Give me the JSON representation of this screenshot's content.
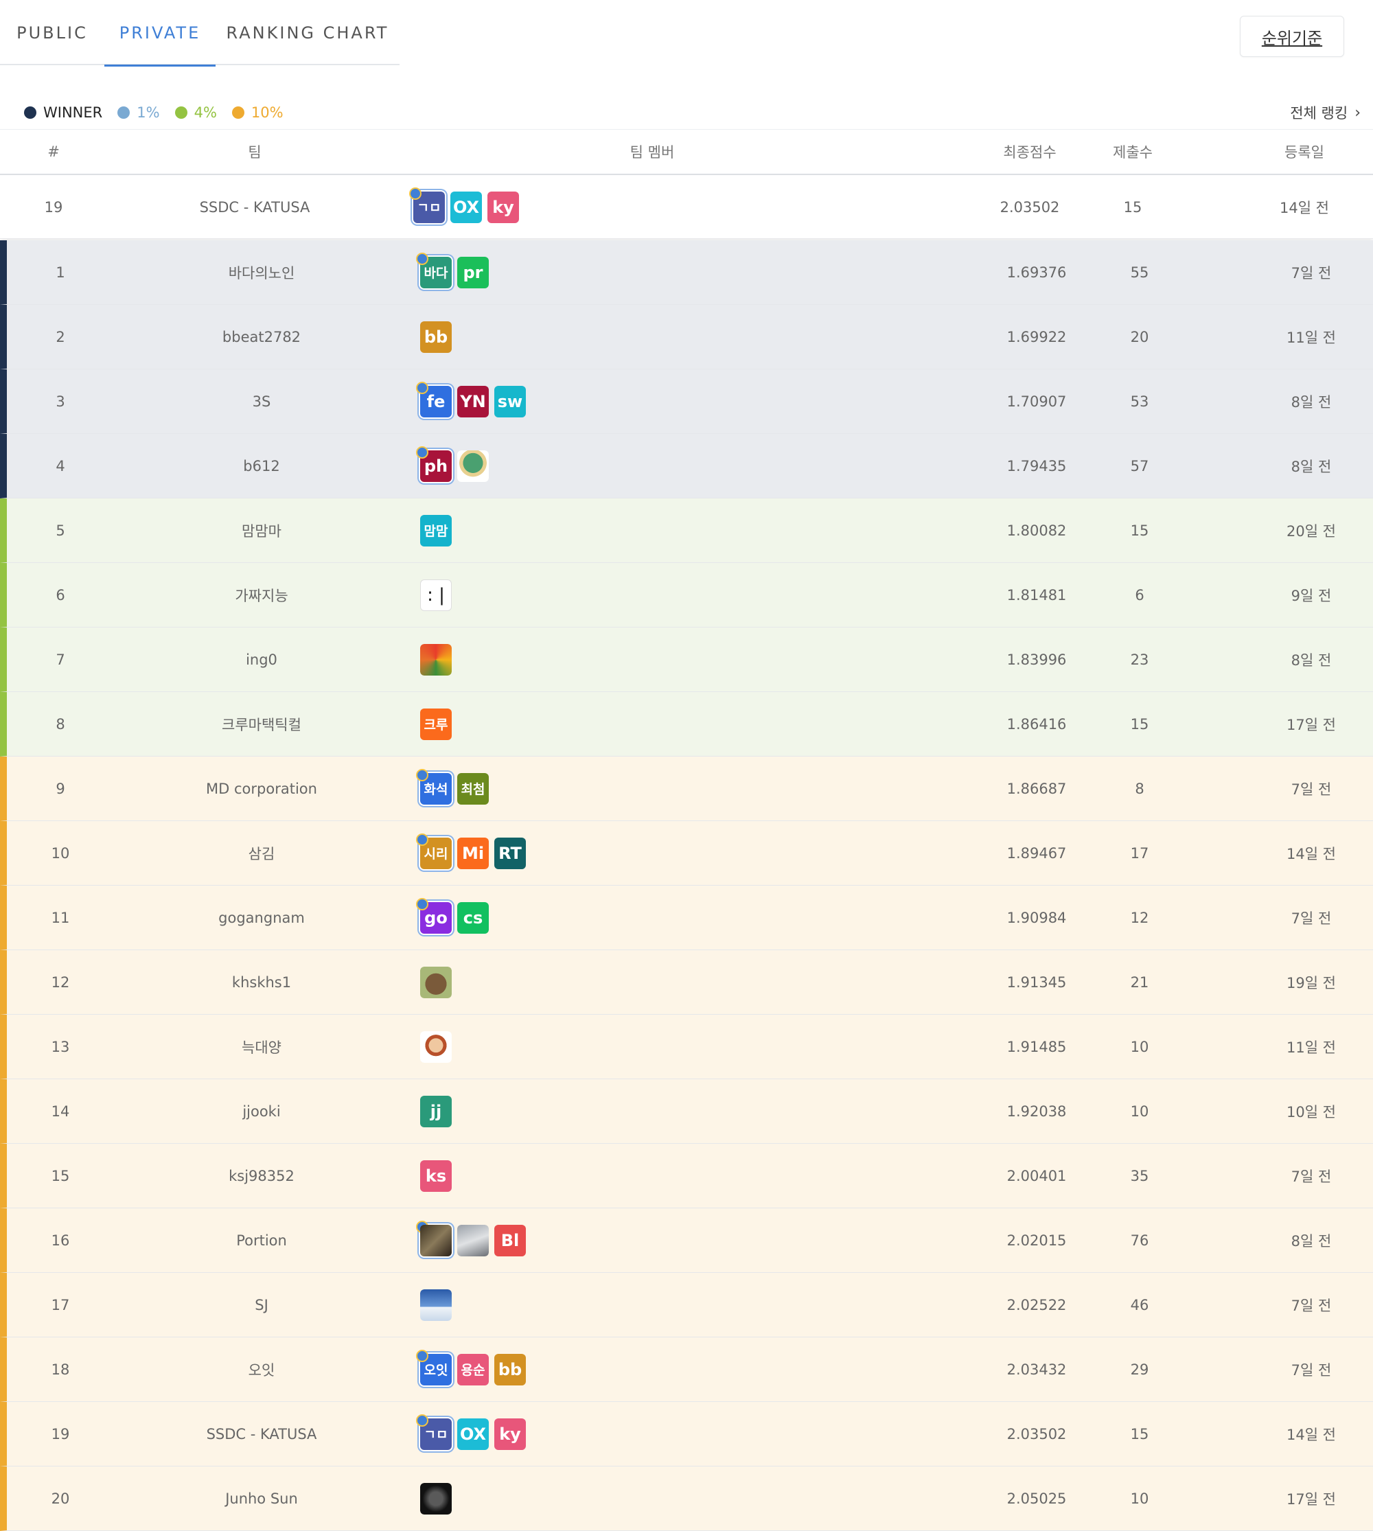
{
  "tabs": [
    {
      "label": "PUBLIC",
      "active": false
    },
    {
      "label": "PRIVATE",
      "active": true
    },
    {
      "label": "RANKING CHART",
      "active": false
    }
  ],
  "rank_criteria_button": "순위기준",
  "legend": [
    {
      "label": "WINNER",
      "color": "#1f3250"
    },
    {
      "label": "1%",
      "color": "#7aa9d2"
    },
    {
      "label": "4%",
      "color": "#94c342"
    },
    {
      "label": "10%",
      "color": "#eeaa30"
    }
  ],
  "all_ranking_link": "전체 랭킹",
  "columns": {
    "rank": "#",
    "team": "팀",
    "members": "팀 멤버",
    "score": "최종점수",
    "submissions": "제출수",
    "registered": "등록일"
  },
  "rows": [
    {
      "rank": "19",
      "team": "SSDC - KATUSA",
      "score": "2.03502",
      "submissions": "15",
      "registered": "14일 전"
    },
    {
      "rank": "1",
      "team": "바다의노인",
      "score": "1.69376",
      "submissions": "55",
      "registered": "7일 전"
    },
    {
      "rank": "2",
      "team": "bbeat2782",
      "score": "1.69922",
      "submissions": "20",
      "registered": "11일 전"
    },
    {
      "rank": "3",
      "team": "3S",
      "score": "1.70907",
      "submissions": "53",
      "registered": "8일 전"
    },
    {
      "rank": "4",
      "team": "b612",
      "score": "1.79435",
      "submissions": "57",
      "registered": "8일 전"
    },
    {
      "rank": "5",
      "team": "맘맘마",
      "score": "1.80082",
      "submissions": "15",
      "registered": "20일 전"
    },
    {
      "rank": "6",
      "team": "가짜지능",
      "score": "1.81481",
      "submissions": "6",
      "registered": "9일 전"
    },
    {
      "rank": "7",
      "team": "ing0",
      "score": "1.83996",
      "submissions": "23",
      "registered": "8일 전"
    },
    {
      "rank": "8",
      "team": "크루마택틱컬",
      "score": "1.86416",
      "submissions": "15",
      "registered": "17일 전"
    },
    {
      "rank": "9",
      "team": "MD corporation",
      "score": "1.86687",
      "submissions": "8",
      "registered": "7일 전"
    },
    {
      "rank": "10",
      "team": "삼김",
      "score": "1.89467",
      "submissions": "17",
      "registered": "14일 전"
    },
    {
      "rank": "11",
      "team": "gogangnam",
      "score": "1.90984",
      "submissions": "12",
      "registered": "7일 전"
    },
    {
      "rank": "12",
      "team": "khskhs1",
      "score": "1.91345",
      "submissions": "21",
      "registered": "19일 전"
    },
    {
      "rank": "13",
      "team": "늑대양",
      "score": "1.91485",
      "submissions": "10",
      "registered": "11일 전"
    },
    {
      "rank": "14",
      "team": "jjooki",
      "score": "1.92038",
      "submissions": "10",
      "registered": "10일 전"
    },
    {
      "rank": "15",
      "team": "ksj98352",
      "score": "2.00401",
      "submissions": "35",
      "registered": "7일 전"
    },
    {
      "rank": "16",
      "team": "Portion",
      "score": "2.02015",
      "submissions": "76",
      "registered": "8일 전"
    },
    {
      "rank": "17",
      "team": "SJ",
      "score": "2.02522",
      "submissions": "46",
      "registered": "7일 전"
    },
    {
      "rank": "18",
      "team": "오잇",
      "score": "2.03432",
      "submissions": "29",
      "registered": "7일 전"
    },
    {
      "rank": "19",
      "team": "SSDC - KATUSA",
      "score": "2.03502",
      "submissions": "15",
      "registered": "14일 전"
    },
    {
      "rank": "20",
      "team": "Junho Sun",
      "score": "2.05025",
      "submissions": "10",
      "registered": "17일 전"
    }
  ],
  "avatars": {
    "r0": [
      {
        "text": "ㄱㅁ",
        "color": "#4a5aa8"
      },
      {
        "text": "OX",
        "color": "#1cbcd6"
      },
      {
        "text": "ky",
        "color": "#e8567a"
      }
    ],
    "r1": [
      {
        "text": "바다",
        "color": "#2a9a7a"
      },
      {
        "text": "pr",
        "color": "#1bbf5a"
      }
    ],
    "r2": [
      {
        "text": "bb",
        "color": "#d39122"
      }
    ],
    "r3": [
      {
        "text": "fe",
        "color": "#2f6fe0"
      },
      {
        "text": "YN",
        "color": "#a8133a"
      },
      {
        "text": "sw",
        "color": "#17b7cc"
      }
    ],
    "r4": [
      {
        "text": "ph",
        "color": "#a8133a"
      }
    ],
    "r5": [
      {
        "text": "맘맘",
        "color": "#14b3cc"
      }
    ],
    "r6": [
      {
        "text": ": |",
        "color": "#ffffff"
      }
    ],
    "r8": [
      {
        "text": "크루",
        "color": "#fb6a1c"
      }
    ],
    "r9": [
      {
        "text": "화석",
        "color": "#2f6fe0"
      },
      {
        "text": "최첨",
        "color": "#6b8a1d"
      }
    ],
    "r10": [
      {
        "text": "시리",
        "color": "#d39122"
      },
      {
        "text": "Mi",
        "color": "#fb6a1c"
      },
      {
        "text": "RT",
        "color": "#126266"
      }
    ],
    "r11": [
      {
        "text": "go",
        "color": "#8a2ce0"
      },
      {
        "text": "cs",
        "color": "#12c060"
      }
    ],
    "r14": [
      {
        "text": "jj",
        "color": "#2a9a7a"
      }
    ],
    "r15": [
      {
        "text": "ks",
        "color": "#e8567a"
      }
    ],
    "r16": [
      {
        "text": "Bl",
        "color": "#e84c4c"
      }
    ],
    "r18": [
      {
        "text": "오잇",
        "color": "#2f6fe0"
      },
      {
        "text": "용순",
        "color": "#e8567a"
      },
      {
        "text": "bb",
        "color": "#d39122"
      }
    ],
    "r19": [
      {
        "text": "ㄱㅁ",
        "color": "#4a5aa8"
      },
      {
        "text": "OX",
        "color": "#1cbcd6"
      },
      {
        "text": "ky",
        "color": "#e8567a"
      }
    ]
  }
}
